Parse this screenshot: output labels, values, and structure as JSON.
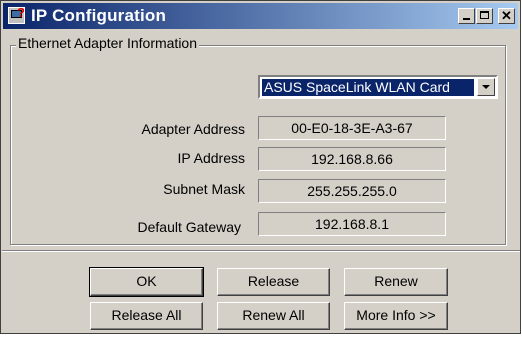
{
  "window": {
    "title": "IP Configuration",
    "close_glyph": "✕"
  },
  "group": {
    "legend": "Ethernet  Adapter Information"
  },
  "adapter_select": {
    "selected": "ASUS SpaceLink WLAN Card"
  },
  "fields": {
    "adapter_address": {
      "label": "Adapter Address",
      "value": "00-E0-18-3E-A3-67"
    },
    "ip_address": {
      "label": "IP Address",
      "value": "192.168.8.66"
    },
    "subnet_mask": {
      "label": "Subnet Mask",
      "value": "255.255.255.0"
    },
    "default_gateway": {
      "label": "Default Gateway",
      "value": "192.168.8.1"
    }
  },
  "buttons": {
    "ok": "OK",
    "release": "Release",
    "renew": "Renew",
    "release_all": "Release All",
    "renew_all": "Renew All",
    "more_info": "More Info >>"
  },
  "icons": {
    "app": "ip-config-question-icon",
    "minimize": "minimize-icon",
    "maximize": "maximize-icon",
    "close": "close-icon",
    "dropdown": "chevron-down-icon"
  },
  "colors": {
    "titlebar_start": "#0a246a",
    "titlebar_end": "#a6caf0",
    "face": "#d4d0c8",
    "selection": "#0a246a"
  }
}
